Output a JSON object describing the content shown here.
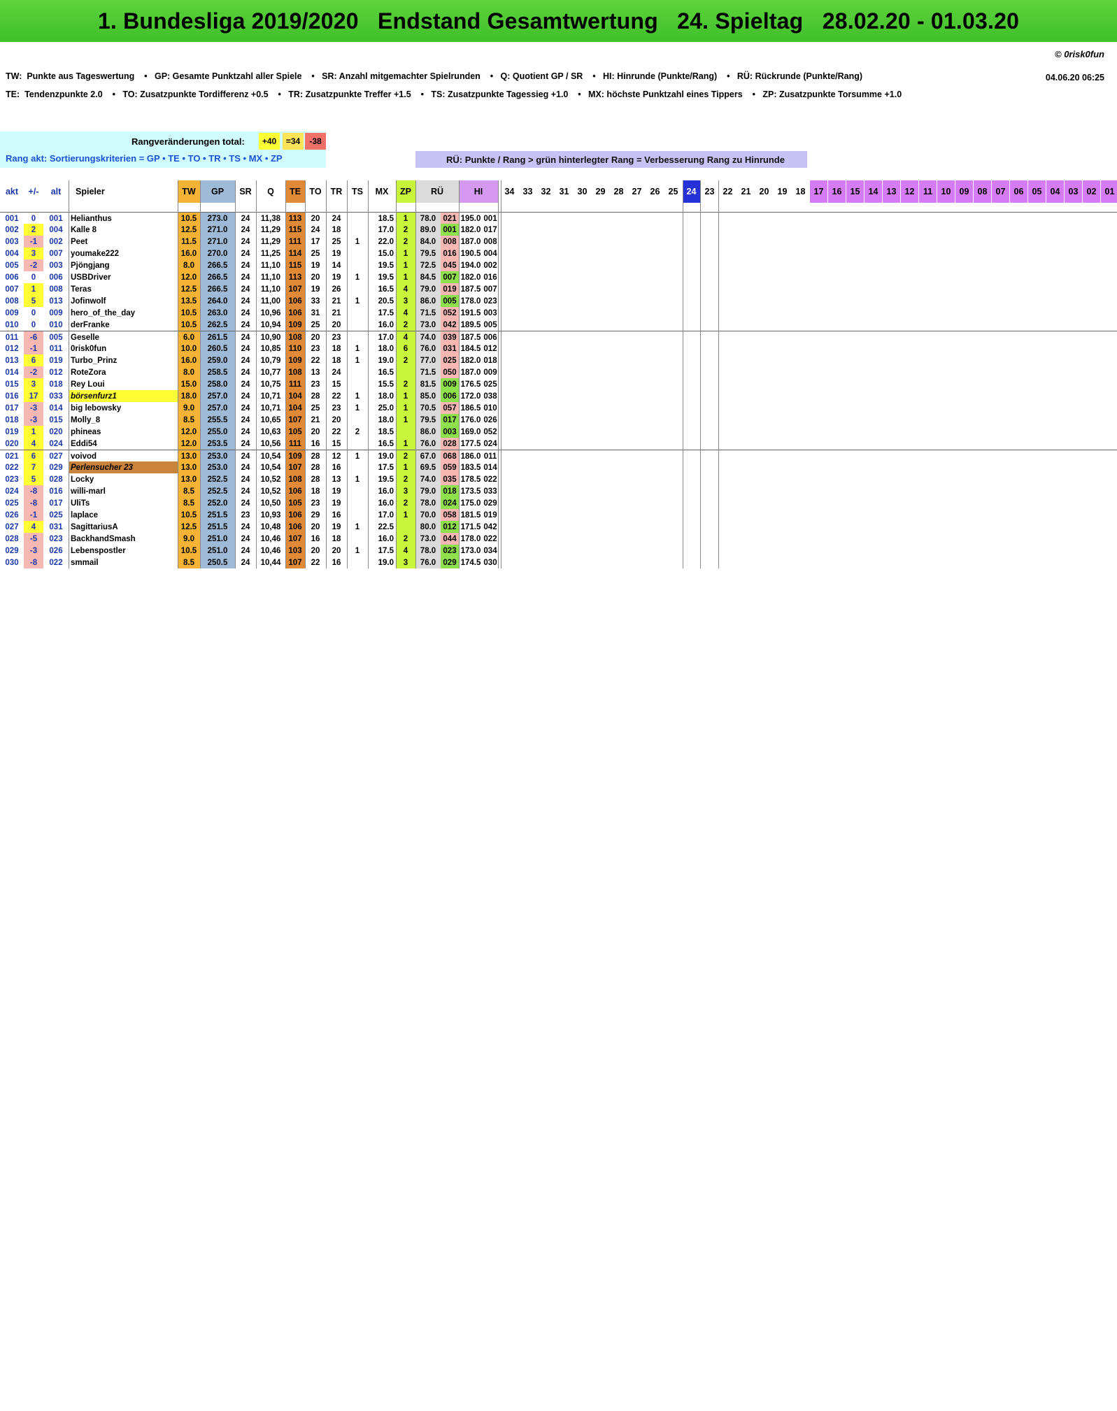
{
  "header": {
    "title": "1. Bundesliga 2019/2020   Endstand Gesamtwertung   24. Spieltag   28.02.20 - 01.03.20",
    "copyright": "© 0risk0fun",
    "timestamp": "04.06.20  06:25",
    "legend1": "TW:  Punkte aus Tageswertung    •   GP: Gesamte Punktzahl aller Spiele    •   SR: Anzahl mitgemachter Spielrunden    •   Q: Quotient GP / SR    •   HI: Hinrunde (Punkte/Rang)    •   RÜ: Rückrunde (Punkte/Rang)",
    "legend2": "TE:  Tendenzpunkte 2.0    •   TO: Zusatzpunkte Tordifferenz +0.5    •   TR: Zusatzpunkte Treffer +1.5    •   TS: Zusatzpunkte Tagessieg +1.0    •   MX: höchste Punktzahl eines Tippers    •   ZP: Zusatzpunkte Torsumme +1.0"
  },
  "rang": {
    "label": "Rangveränderungen total:",
    "up": "+40",
    "same": "=34",
    "down": "-38",
    "sort_line": "Rang akt: Sortierungskriterien = GP  •  TE  •  TO  •  TR  •  TS  •  MX  •  ZP",
    "ru_note": "RÜ: Punkte / Rang > grün hinterlegter Rang = Verbesserung Rang zu Hinrunde"
  },
  "columns": [
    "akt",
    "+/-",
    "alt",
    "Spieler",
    "TW",
    "GP",
    "SR",
    "Q",
    "TE",
    "TO",
    "TR",
    "TS",
    "MX",
    "ZP",
    "RÜ",
    "HI"
  ],
  "matchdays": [
    "34",
    "33",
    "32",
    "31",
    "30",
    "29",
    "28",
    "27",
    "26",
    "25",
    "24",
    "23",
    "22",
    "21",
    "20",
    "19",
    "18",
    "17",
    "16",
    "15",
    "14",
    "13",
    "12",
    "11",
    "10",
    "09",
    "08",
    "07",
    "06",
    "05",
    "04",
    "03",
    "02",
    "01"
  ],
  "colors": {
    "banner": "#3fbf2a",
    "tw": "#f5b335",
    "gp": "#9fbad6",
    "te": "#e08a38",
    "zp": "#c8f43c",
    "hi": "#d39af0",
    "up": "#ffff33",
    "down": "#f2706a"
  },
  "rows": [
    [
      "001",
      "0",
      "001",
      "Helianthus",
      "10.5",
      "273.0",
      "24",
      "11,38",
      "113",
      "20",
      "24",
      "",
      "18.5",
      "1",
      "78.0",
      "021",
      "195.0",
      "001"
    ],
    [
      "002",
      "2",
      "004",
      "Kalle 8",
      "12.5",
      "271.0",
      "24",
      "11,29",
      "115",
      "24",
      "18",
      "",
      "17.0",
      "2",
      "89.0",
      "001",
      "182.0",
      "017"
    ],
    [
      "003",
      "-1",
      "002",
      "Peet",
      "11.5",
      "271.0",
      "24",
      "11,29",
      "111",
      "17",
      "25",
      "1",
      "22.0",
      "2",
      "84.0",
      "008",
      "187.0",
      "008"
    ],
    [
      "004",
      "3",
      "007",
      "youmake222",
      "16.0",
      "270.0",
      "24",
      "11,25",
      "114",
      "25",
      "19",
      "",
      "15.0",
      "1",
      "79.5",
      "016",
      "190.5",
      "004"
    ],
    [
      "005",
      "-2",
      "003",
      "Pjöngjang",
      "8.0",
      "266.5",
      "24",
      "11,10",
      "115",
      "19",
      "14",
      "",
      "19.5",
      "1",
      "72.5",
      "045",
      "194.0",
      "002"
    ],
    [
      "006",
      "0",
      "006",
      "USBDriver",
      "12.0",
      "266.5",
      "24",
      "11,10",
      "113",
      "20",
      "19",
      "1",
      "19.5",
      "1",
      "84.5",
      "007",
      "182.0",
      "016"
    ],
    [
      "007",
      "1",
      "008",
      "Teras",
      "12.5",
      "266.5",
      "24",
      "11,10",
      "107",
      "19",
      "26",
      "",
      "16.5",
      "4",
      "79.0",
      "019",
      "187.5",
      "007"
    ],
    [
      "008",
      "5",
      "013",
      "Jofinwolf",
      "13.5",
      "264.0",
      "24",
      "11,00",
      "106",
      "33",
      "21",
      "1",
      "20.5",
      "3",
      "86.0",
      "005",
      "178.0",
      "023"
    ],
    [
      "009",
      "0",
      "009",
      "hero_of_the_day",
      "10.5",
      "263.0",
      "24",
      "10,96",
      "106",
      "31",
      "21",
      "",
      "17.5",
      "4",
      "71.5",
      "052",
      "191.5",
      "003"
    ],
    [
      "010",
      "0",
      "010",
      "derFranke",
      "10.5",
      "262.5",
      "24",
      "10,94",
      "109",
      "25",
      "20",
      "",
      "16.0",
      "2",
      "73.0",
      "042",
      "189.5",
      "005"
    ],
    [
      "011",
      "-6",
      "005",
      "Geselle",
      "6.0",
      "261.5",
      "24",
      "10,90",
      "108",
      "20",
      "23",
      "",
      "17.0",
      "4",
      "74.0",
      "039",
      "187.5",
      "006"
    ],
    [
      "012",
      "-1",
      "011",
      "0risk0fun",
      "10.0",
      "260.5",
      "24",
      "10,85",
      "110",
      "23",
      "18",
      "1",
      "18.0",
      "6",
      "76.0",
      "031",
      "184.5",
      "012"
    ],
    [
      "013",
      "6",
      "019",
      "Turbo_Prinz",
      "16.0",
      "259.0",
      "24",
      "10,79",
      "109",
      "22",
      "18",
      "1",
      "19.0",
      "2",
      "77.0",
      "025",
      "182.0",
      "018"
    ],
    [
      "014",
      "-2",
      "012",
      "RoteZora",
      "8.0",
      "258.5",
      "24",
      "10,77",
      "108",
      "13",
      "24",
      "",
      "16.5",
      "",
      "71.5",
      "050",
      "187.0",
      "009"
    ],
    [
      "015",
      "3",
      "018",
      "Rey Loui",
      "15.0",
      "258.0",
      "24",
      "10,75",
      "111",
      "23",
      "15",
      "",
      "15.5",
      "2",
      "81.5",
      "009",
      "176.5",
      "025"
    ],
    [
      "016",
      "17",
      "033",
      "börsenfurz1",
      "18.0",
      "257.0",
      "24",
      "10,71",
      "104",
      "28",
      "22",
      "1",
      "18.0",
      "1",
      "85.0",
      "006",
      "172.0",
      "038"
    ],
    [
      "017",
      "-3",
      "014",
      "big lebowsky",
      "9.0",
      "257.0",
      "24",
      "10,71",
      "104",
      "25",
      "23",
      "1",
      "25.0",
      "1",
      "70.5",
      "057",
      "186.5",
      "010"
    ],
    [
      "018",
      "-3",
      "015",
      "Molly_8",
      "8.5",
      "255.5",
      "24",
      "10,65",
      "107",
      "21",
      "20",
      "",
      "18.0",
      "1",
      "79.5",
      "017",
      "176.0",
      "026"
    ],
    [
      "019",
      "1",
      "020",
      "phineas",
      "12.0",
      "255.0",
      "24",
      "10,63",
      "105",
      "20",
      "22",
      "2",
      "18.5",
      "",
      "86.0",
      "003",
      "169.0",
      "052"
    ],
    [
      "020",
      "4",
      "024",
      "Eddi54",
      "12.0",
      "253.5",
      "24",
      "10,56",
      "111",
      "16",
      "15",
      "",
      "16.5",
      "1",
      "76.0",
      "028",
      "177.5",
      "024"
    ],
    [
      "021",
      "6",
      "027",
      "voivod",
      "13.0",
      "253.0",
      "24",
      "10,54",
      "109",
      "28",
      "12",
      "1",
      "19.0",
      "2",
      "67.0",
      "068",
      "186.0",
      "011"
    ],
    [
      "022",
      "7",
      "029",
      "Perlensucher 23",
      "13.0",
      "253.0",
      "24",
      "10,54",
      "107",
      "28",
      "16",
      "",
      "17.5",
      "1",
      "69.5",
      "059",
      "183.5",
      "014"
    ],
    [
      "023",
      "5",
      "028",
      "Locky",
      "13.0",
      "252.5",
      "24",
      "10,52",
      "108",
      "28",
      "13",
      "1",
      "19.5",
      "2",
      "74.0",
      "035",
      "178.5",
      "022"
    ],
    [
      "024",
      "-8",
      "016",
      "willi-marl",
      "8.5",
      "252.5",
      "24",
      "10,52",
      "106",
      "18",
      "19",
      "",
      "16.0",
      "3",
      "79.0",
      "018",
      "173.5",
      "033"
    ],
    [
      "025",
      "-8",
      "017",
      "UliTs",
      "8.5",
      "252.0",
      "24",
      "10,50",
      "105",
      "23",
      "19",
      "",
      "16.0",
      "2",
      "78.0",
      "024",
      "175.0",
      "029"
    ],
    [
      "026",
      "-1",
      "025",
      "laplace",
      "10.5",
      "251.5",
      "23",
      "10,93",
      "106",
      "29",
      "16",
      "",
      "17.0",
      "1",
      "70.0",
      "058",
      "181.5",
      "019"
    ],
    [
      "027",
      "4",
      "031",
      "SagittariusA",
      "12.5",
      "251.5",
      "24",
      "10,48",
      "106",
      "20",
      "19",
      "1",
      "22.5",
      "",
      "80.0",
      "012",
      "171.5",
      "042"
    ],
    [
      "028",
      "-5",
      "023",
      "BackhandSmash",
      "9.0",
      "251.0",
      "24",
      "10,46",
      "107",
      "16",
      "18",
      "",
      "16.0",
      "2",
      "73.0",
      "044",
      "178.0",
      "022"
    ],
    [
      "029",
      "-3",
      "026",
      "Lebenspostler",
      "10.5",
      "251.0",
      "24",
      "10,46",
      "103",
      "20",
      "20",
      "1",
      "17.5",
      "4",
      "78.0",
      "023",
      "173.0",
      "034"
    ],
    [
      "030",
      "-8",
      "022",
      "smmail",
      "8.5",
      "250.5",
      "24",
      "10,44",
      "107",
      "22",
      "16",
      "",
      "19.0",
      "3",
      "76.0",
      "029",
      "174.5",
      "030"
    ]
  ],
  "hidden_rows_note": ""
}
